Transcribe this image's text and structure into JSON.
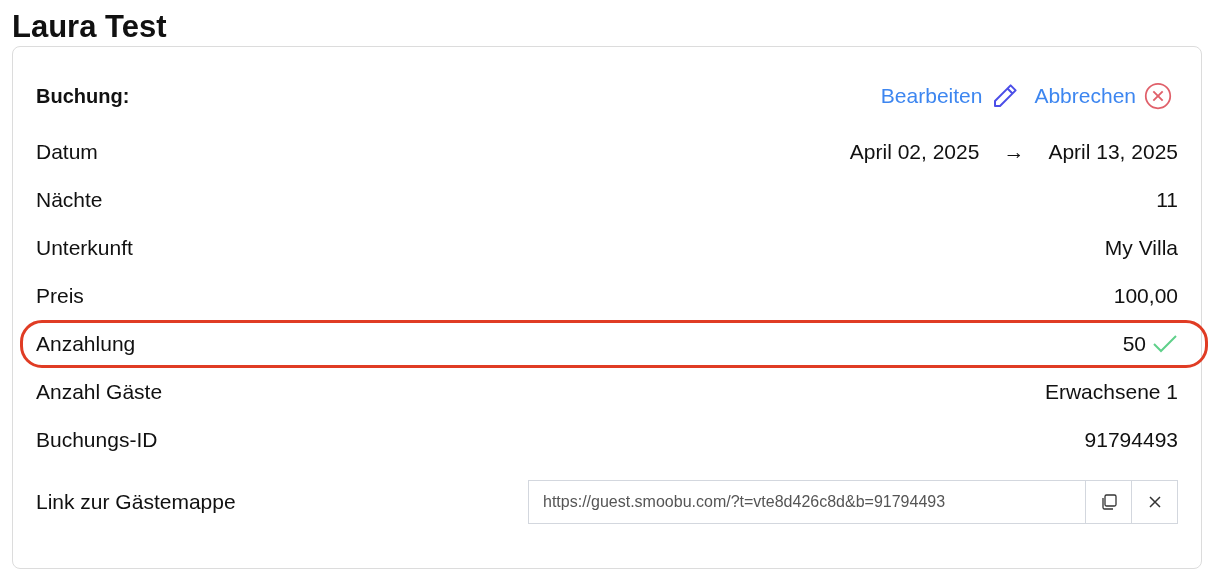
{
  "title": "Laura Test",
  "card": {
    "heading": "Buchung:",
    "actions": [
      {
        "label": "Bearbeiten",
        "kind": "edit"
      },
      {
        "label": "Abbrechen",
        "kind": "cancel"
      }
    ],
    "rows": [
      {
        "kind": "date",
        "label": "Datum",
        "from": "April 02, 2025",
        "arrow": "→",
        "to": "April 13, 2025",
        "highlighted": false
      },
      {
        "kind": "text",
        "label": "Nächte",
        "value": "11",
        "highlighted": false
      },
      {
        "kind": "text",
        "label": "Unterkunft",
        "value": "My Villa",
        "highlighted": false
      },
      {
        "kind": "text",
        "label": "Preis",
        "value": "100,00",
        "highlighted": false
      },
      {
        "kind": "paid",
        "label": "Anzahlung",
        "value": "50",
        "paid": true,
        "highlighted": true
      },
      {
        "kind": "text",
        "label": "Anzahl Gäste",
        "value": "Erwachsene 1",
        "highlighted": false
      },
      {
        "kind": "text",
        "label": "Buchungs-ID",
        "value": "91794493",
        "highlighted": false
      },
      {
        "kind": "link",
        "label": "Link zur Gästemappe",
        "value": "https://guest.smoobu.com/?t=vte8d426c8d&b=91794493",
        "highlighted": false
      }
    ]
  }
}
